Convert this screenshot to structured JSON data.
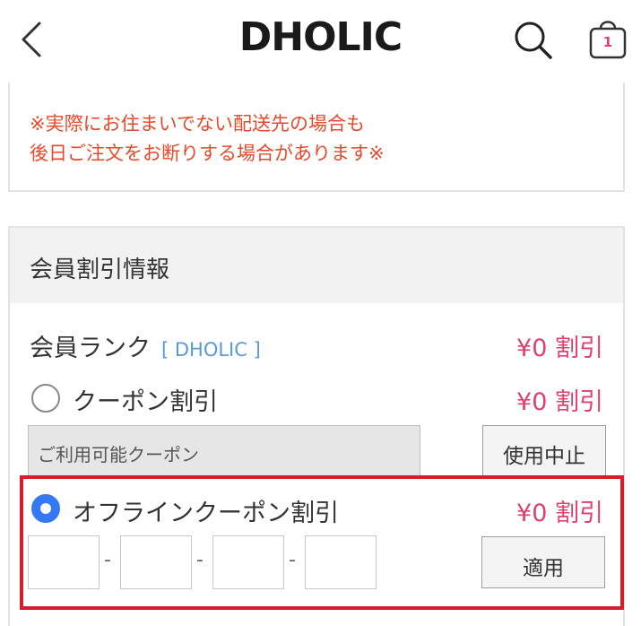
{
  "header": {
    "logo": "DHOLIC",
    "cart_count": "1"
  },
  "notice": {
    "line1": "※実際にお住まいでない配送先の場合も",
    "line2": "後日ご注文をお断りする場合があります※"
  },
  "discount": {
    "title": "会員割引情報",
    "member_rank_label": "会員ランク",
    "member_rank_value": "[ DHOLIC ]",
    "member_rank_amount": "¥0 割引",
    "coupon_label": "クーポン割引",
    "coupon_amount": "¥0 割引",
    "coupon_select_placeholder": "ご利用可能クーポン",
    "stop_button": "使用中止",
    "offline_label": "オフラインクーポン割引",
    "offline_amount": "¥0 割引",
    "apply_button": "適用",
    "code_separator": "-",
    "offline_selected": true
  },
  "colors": {
    "notice_red": "#e8492a",
    "amount_pink": "#e0406e",
    "rank_blue": "#5b9bd5",
    "radio_blue": "#3478f6",
    "highlight_red": "#d41e2b"
  },
  "icons": [
    "back-arrow-icon",
    "search-icon",
    "shopping-bag-icon"
  ]
}
